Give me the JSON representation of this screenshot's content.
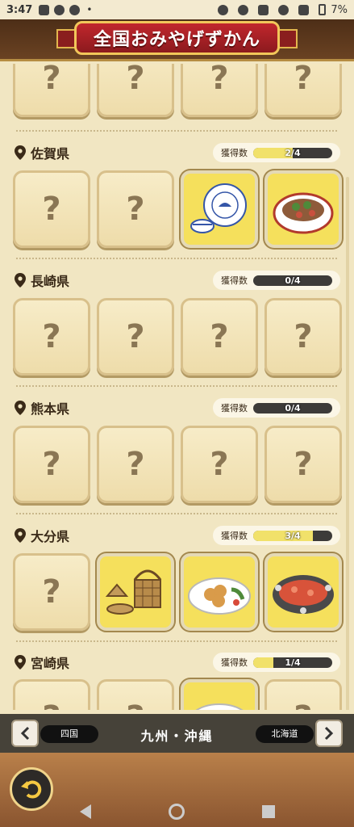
{
  "status_bar": {
    "time": "3:47",
    "battery": "7%",
    "left_icons": [
      "line-icon",
      "youtube-icon",
      "facebook-icon",
      "dot-icon"
    ],
    "right_icons": [
      "alarm-icon",
      "location-icon",
      "vibrate-icon",
      "wifi-icon",
      "signal-icon",
      "battery-icon"
    ]
  },
  "header": {
    "title": "全国おみやげずかん"
  },
  "count_label": "獲得数",
  "unknown_mark": "?",
  "prefectures": [
    {
      "name": "佐賀県",
      "count": "2/4",
      "fraction": 0.5,
      "cards": [
        "unknown",
        "unknown",
        "blue-white-porcelain-icon",
        "sashimi-bowl-icon"
      ]
    },
    {
      "name": "長崎県",
      "count": "0/4",
      "fraction": 0.0,
      "cards": [
        "unknown",
        "unknown",
        "unknown",
        "unknown"
      ]
    },
    {
      "name": "熊本県",
      "count": "0/4",
      "fraction": 0.0,
      "cards": [
        "unknown",
        "unknown",
        "unknown",
        "unknown"
      ]
    },
    {
      "name": "大分県",
      "count": "3/4",
      "fraction": 0.75,
      "cards": [
        "unknown",
        "bamboo-basket-icon",
        "fried-chicken-plate-icon",
        "hot-spring-pot-icon"
      ]
    },
    {
      "name": "宮崎県",
      "count": "1/4",
      "fraction": 0.25,
      "cards": [
        "unknown",
        "unknown",
        "chicken-nanban-plate-icon",
        "unknown"
      ]
    }
  ],
  "region_nav": {
    "prev_region": "四国",
    "current_region": "九州・沖縄",
    "next_region": "北海道"
  },
  "colors": {
    "owned_card_bg": "#f5e05c",
    "header_red": "#c1272d",
    "count_fill": "#f1e16a"
  }
}
